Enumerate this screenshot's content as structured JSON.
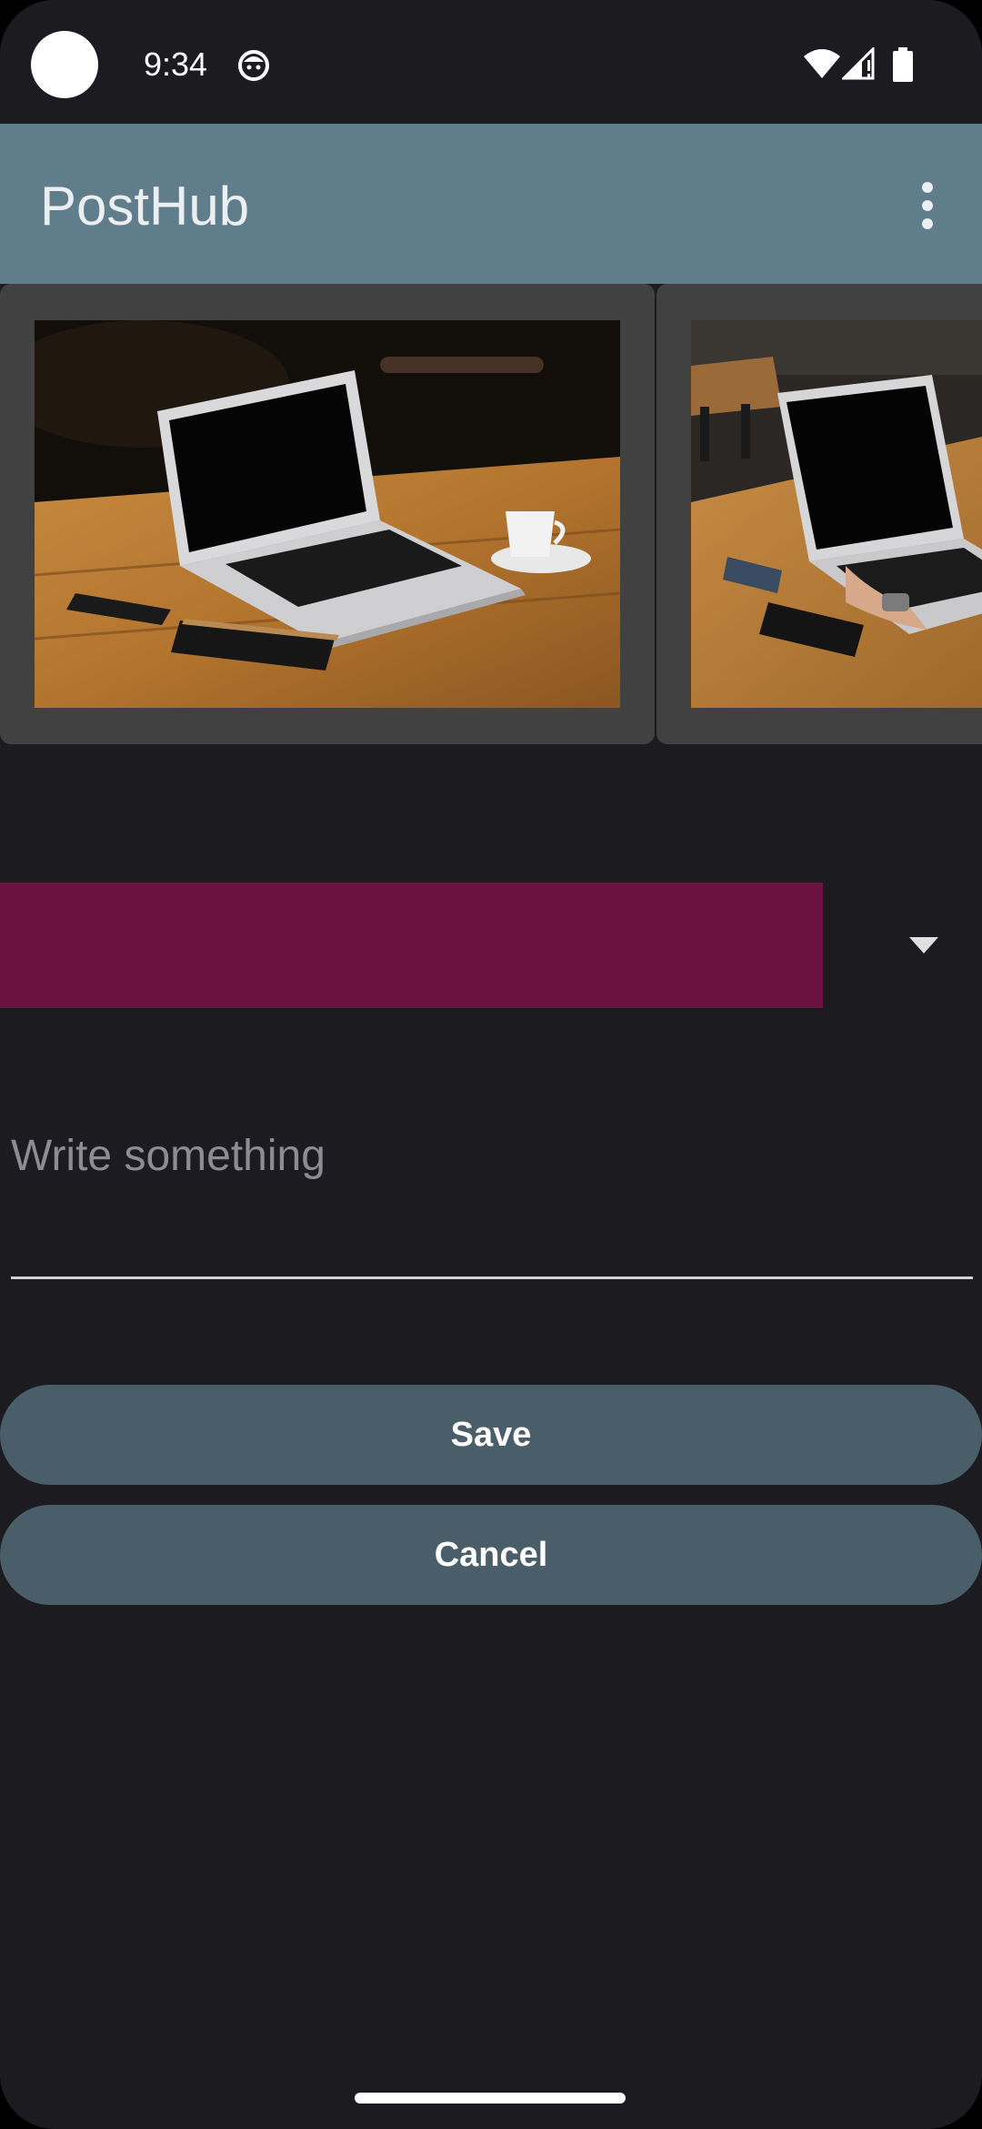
{
  "status_bar": {
    "time": "9:34",
    "icons": [
      "camera-cutout",
      "app-notification-icon",
      "wifi-icon",
      "cell-signal-icon",
      "battery-icon"
    ]
  },
  "app_bar": {
    "title": "PostHub",
    "menu_icon": "more-vert-icon"
  },
  "carousel": {
    "photos": [
      {
        "name": "laptop-on-wooden-table-photo"
      },
      {
        "name": "person-typing-on-laptop-photo"
      }
    ]
  },
  "category_spinner": {
    "selected_value": "",
    "arrow_icon": "dropdown-arrow-icon"
  },
  "post_input": {
    "value": "",
    "placeholder": "Write something"
  },
  "actions": {
    "save_label": "Save",
    "cancel_label": "Cancel"
  },
  "colors": {
    "background": "#1c1b20",
    "app_bar": "#607d8b",
    "spinner": "#6a1340",
    "button": "#4a5e69",
    "card": "#414141"
  }
}
